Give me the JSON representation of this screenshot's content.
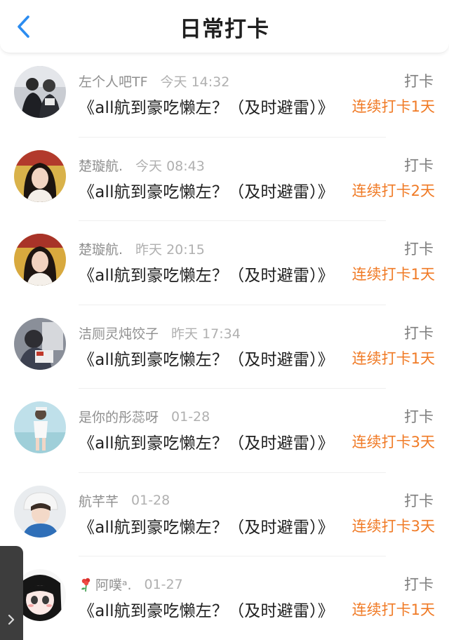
{
  "header": {
    "title": "日常打卡",
    "back_icon": "chevron-left-icon"
  },
  "colors": {
    "accent_blue": "#2b8cf0",
    "streak_orange": "#f07a25"
  },
  "entries": [
    {
      "username": "左个人吧TF",
      "time": "今天 14:32",
      "label": "打卡",
      "content": "《all航到豪吃懒左？（及时避雷）》",
      "streak": "连续打卡1天"
    },
    {
      "username": "楚璇航.",
      "time": "今天 08:43",
      "label": "打卡",
      "content": "《all航到豪吃懒左？（及时避雷）》",
      "streak": "连续打卡2天"
    },
    {
      "username": "楚璇航.",
      "time": "昨天 20:15",
      "label": "打卡",
      "content": "《all航到豪吃懒左？（及时避雷）》",
      "streak": "连续打卡1天"
    },
    {
      "username": "洁厕灵炖饺子",
      "time": "昨天 17:34",
      "label": "打卡",
      "content": "《all航到豪吃懒左？（及时避雷）》",
      "streak": "连续打卡1天"
    },
    {
      "username": "是你的彤蕊呀",
      "time": "01-28",
      "label": "打卡",
      "content": "《all航到豪吃懒左？（及时避雷）》",
      "streak": "连续打卡3天"
    },
    {
      "username": "航芊芊",
      "time": "01-28",
      "label": "打卡",
      "content": "《all航到豪吃懒左？（及时避雷）》",
      "streak": "连续打卡3天"
    },
    {
      "username": "阿噗ᵃ.",
      "time": "01-27",
      "label": "打卡",
      "content": "《all航到豪吃懒左？（及时避雷）》",
      "streak": "连续打卡1天",
      "name_icon": "flower-icon"
    }
  ],
  "side_tab": {
    "icon": "chevron-right-icon"
  }
}
